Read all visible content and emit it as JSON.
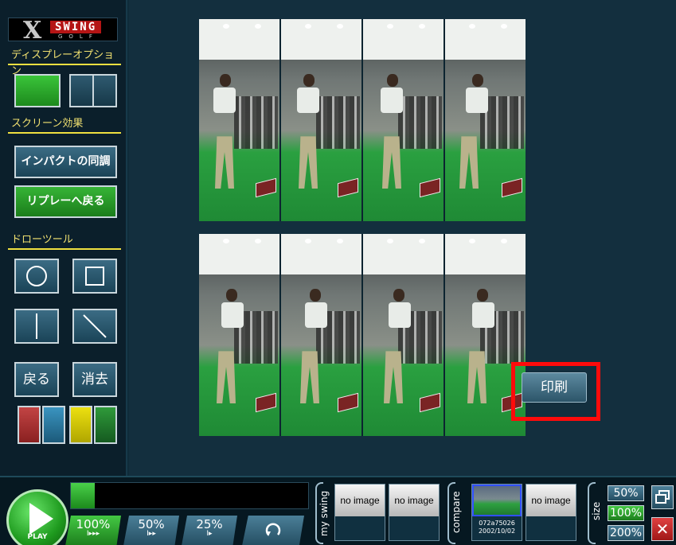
{
  "logo": {
    "x": "X",
    "swing": "SWING",
    "golf": "GOLF"
  },
  "sidebar": {
    "display_options_label": "ディスプレーオプション",
    "screen_effects_label": "スクリーン効果",
    "sync_impact_label": "インパクトの同調",
    "back_to_replay_label": "リプレーへ戻る",
    "draw_tools_label": "ドローツール",
    "undo_label": "戻る",
    "clear_label": "消去",
    "colors": [
      "#b33a3a",
      "#2c7aa0",
      "#d8cc10",
      "#1f7a2c"
    ]
  },
  "main": {
    "print_label": "印刷"
  },
  "bottom": {
    "play_label": "PLAY",
    "progress": 0.1,
    "speeds": [
      {
        "pct": "100%",
        "icon": "I▸▸▸",
        "active": true
      },
      {
        "pct": "50%",
        "icon": "I▸▸",
        "active": false
      },
      {
        "pct": "25%",
        "icon": "I▸",
        "active": false
      }
    ],
    "my_swing_label": "my swing",
    "compare_label": "compare",
    "no_image_1": "no image",
    "no_image_2": "no image",
    "no_image_3": "no image",
    "compare_id": "072a75026",
    "compare_date": "2002/10/02",
    "size_label": "size",
    "size_50": "50%",
    "size_100": "100%",
    "size_200": "200%"
  }
}
